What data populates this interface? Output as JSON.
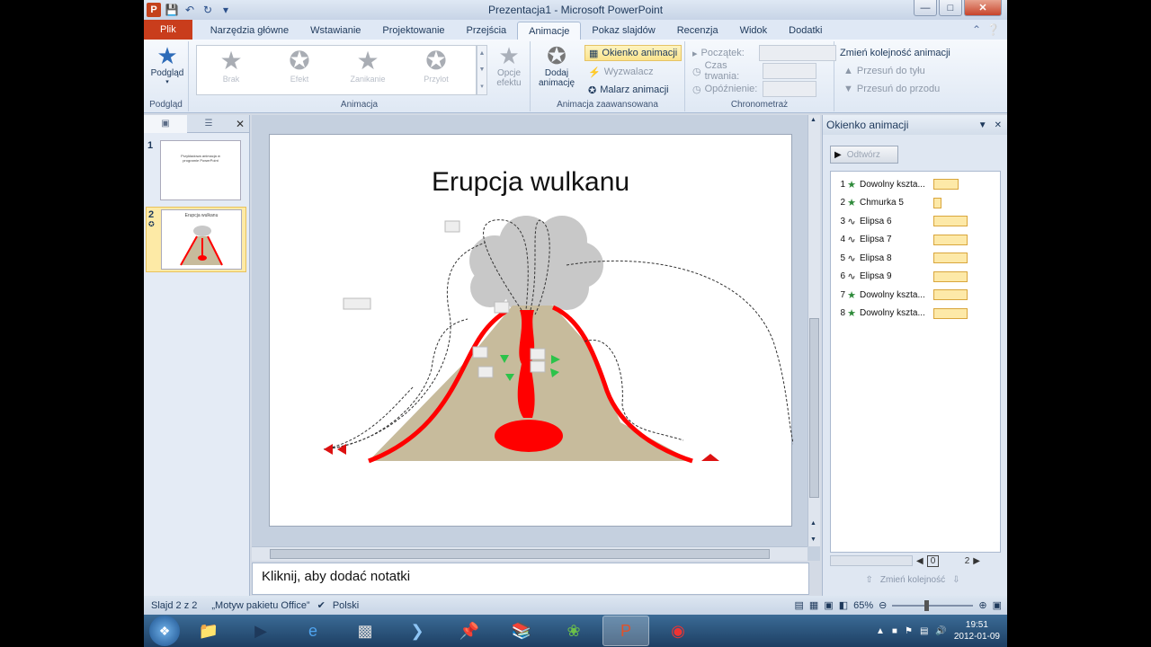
{
  "window": {
    "title": "Prezentacja1 - Microsoft PowerPoint",
    "logo": "P"
  },
  "tabs": [
    {
      "label": "Plik"
    },
    {
      "label": "Narzędzia główne"
    },
    {
      "label": "Wstawianie"
    },
    {
      "label": "Projektowanie"
    },
    {
      "label": "Przejścia"
    },
    {
      "label": "Animacje"
    },
    {
      "label": "Pokaz slajdów"
    },
    {
      "label": "Recenzja"
    },
    {
      "label": "Widok"
    },
    {
      "label": "Dodatki"
    }
  ],
  "ribbon": {
    "podglad": {
      "button": "Podgląd",
      "group": "Podgląd"
    },
    "animacja": {
      "group": "Animacja",
      "gallery": [
        "Brak",
        "Efekt",
        "Zanikanie",
        "Przylot"
      ],
      "opcje": "Opcje efektu"
    },
    "zaawansowana": {
      "group": "Animacja zaawansowana",
      "dodaj": "Dodaj animację",
      "okienko": "Okienko animacji",
      "wyzwalacz": "Wyzwalacz",
      "malarz": "Malarz animacji"
    },
    "chronometraz": {
      "group": "Chronometraż",
      "poczatek": "Początek:",
      "czas": "Czas trwania:",
      "opoznienie": "Opóźnienie:"
    },
    "kolejnosc": {
      "title": "Zmień kolejność animacji",
      "tyl": "Przesuń do tyłu",
      "przod": "Przesuń do przodu"
    }
  },
  "slides": [
    {
      "num": "1",
      "title": "Przykładowa animacja w programie PowerPoint"
    },
    {
      "num": "2",
      "title": "Erupcja wulkanu"
    }
  ],
  "slide": {
    "title": "Erupcja wulkanu"
  },
  "notes": {
    "placeholder": "Kliknij, aby dodać notatki"
  },
  "anim_pane": {
    "title": "Okienko animacji",
    "play": "Odtwórz",
    "items": [
      {
        "num": "1",
        "icon": "star",
        "label": "Dowolny kszta...",
        "bar": 0.55
      },
      {
        "num": "2",
        "icon": "star",
        "label": "Chmurka 5",
        "bar": 0.18
      },
      {
        "num": "3",
        "icon": "path",
        "label": "Elipsa 6",
        "bar": 0.75
      },
      {
        "num": "4",
        "icon": "path",
        "label": "Elipsa 7",
        "bar": 0.75
      },
      {
        "num": "5",
        "icon": "path",
        "label": "Elipsa 8",
        "bar": 0.75
      },
      {
        "num": "6",
        "icon": "path",
        "label": "Elipsa 9",
        "bar": 0.75
      },
      {
        "num": "7",
        "icon": "star",
        "label": "Dowolny kszta...",
        "bar": 0.75
      },
      {
        "num": "8",
        "icon": "star",
        "label": "Dowolny kszta...",
        "bar": 0.75
      }
    ],
    "timeline_start": "0",
    "timeline_end": "2",
    "reorder": "Zmień kolejność"
  },
  "status": {
    "slide": "Slajd 2 z 2",
    "theme": "„Motyw pakietu Office”",
    "language": "Polski",
    "zoom": "65%"
  },
  "taskbar": {
    "time": "19:51",
    "date": "2012-01-09"
  },
  "colors": {
    "lava": "#ff0000",
    "mountain": "#c7bb9c",
    "smoke": "#c8c8c8",
    "file_tab": "#c93d1c"
  }
}
